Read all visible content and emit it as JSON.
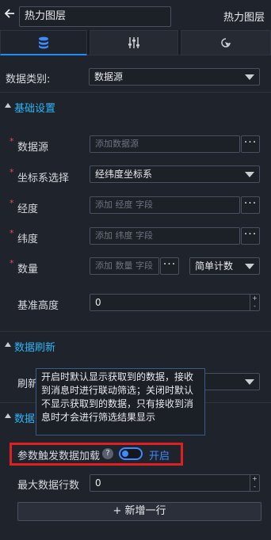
{
  "header": {
    "back_icon": "arrow-left-icon",
    "name_value": "热力图层",
    "title": "热力图层"
  },
  "tabs": [
    {
      "icon": "database-icon",
      "active": true
    },
    {
      "icon": "sliders-icon",
      "active": false
    },
    {
      "icon": "pointer-icon",
      "active": false
    }
  ],
  "data_category": {
    "label": "数据类别:",
    "value": "数据源"
  },
  "basic": {
    "title": "基础设置",
    "datasource": {
      "label": "数据源",
      "placeholder": "添加数据源",
      "more": "···"
    },
    "coord": {
      "label": "坐标系选择",
      "value": "经纬度坐标系"
    },
    "lng": {
      "label": "经度",
      "placeholder": "添加 经度 字段",
      "more": "···"
    },
    "lat": {
      "label": "纬度",
      "placeholder": "添加 纬度 字段",
      "more": "···"
    },
    "count": {
      "label": "数量",
      "placeholder": "添加 数量 字段",
      "more": "···",
      "agg": "简单计数"
    },
    "base_height": {
      "label": "基准高度",
      "value": "0"
    }
  },
  "refresh": {
    "title": "数据刷新",
    "label_partial": "刷新",
    "section_partial": "数据"
  },
  "tooltip_text": "开启时默认显示获取到的数据，接收到消息时进行联动筛选；关闭时默认不显示获取到的数据，只有接收到消息时才会进行筛选结果显示",
  "param_load": {
    "label": "参数触发数据加载",
    "help": "?",
    "state": "开启"
  },
  "max_rows": {
    "label": "最大数据行数",
    "value": "0"
  },
  "add_button": {
    "label": "新增一行"
  },
  "colors": {
    "accent": "#1c8cff",
    "section_title": "#29b6f6",
    "required": "#e84b4b",
    "highlight": "#e02020"
  }
}
